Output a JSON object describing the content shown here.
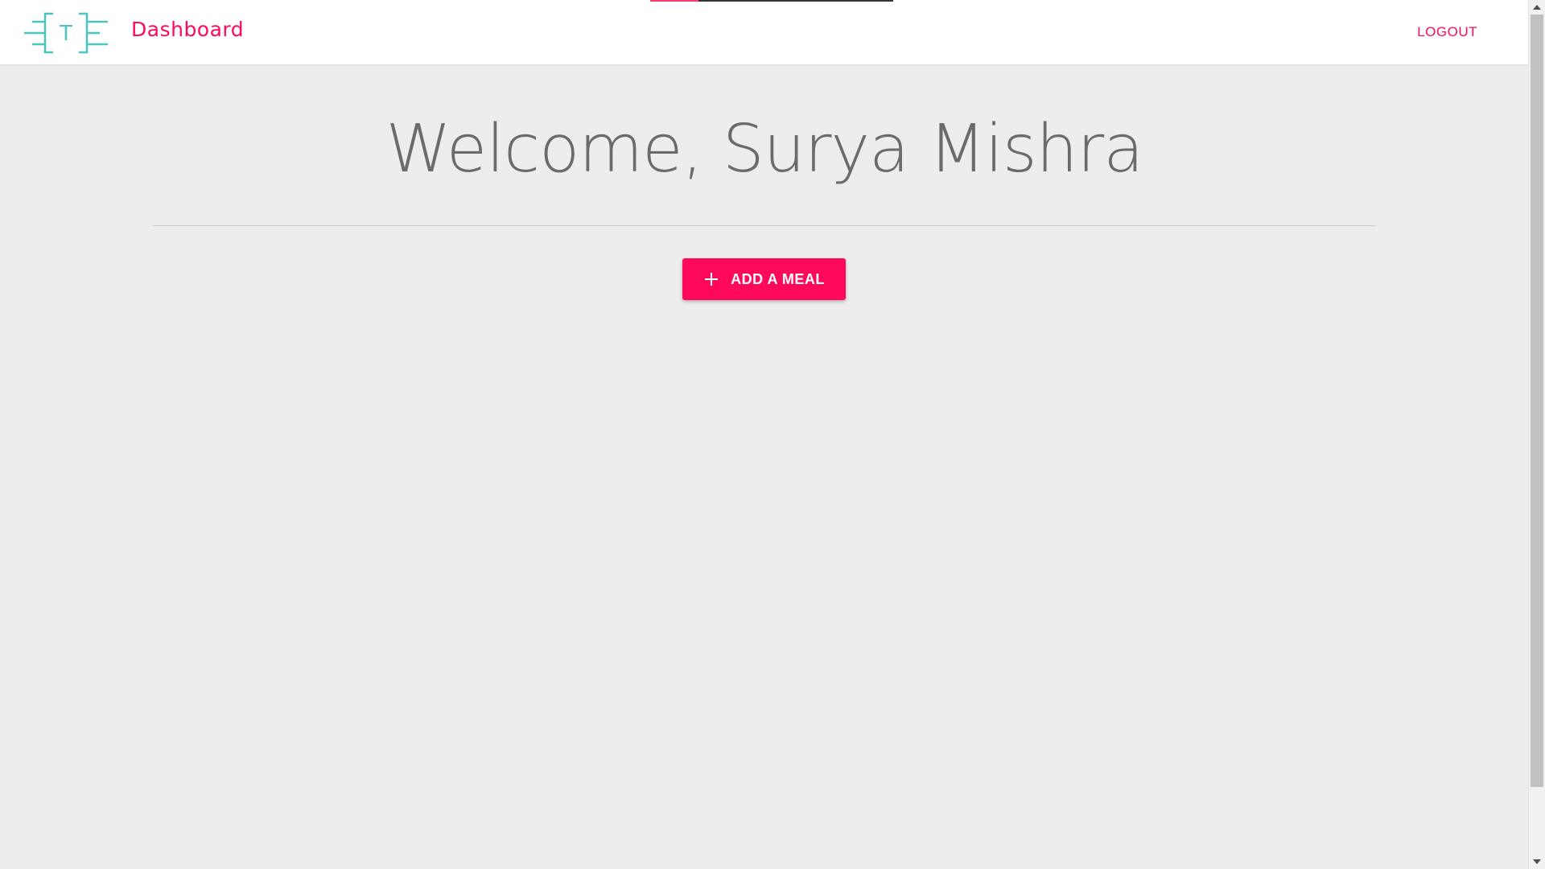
{
  "header": {
    "title": "Dashboard",
    "logo_letter": "T",
    "logout_label": "LOGOUT"
  },
  "main": {
    "welcome_text": "Welcome, Surya Mishra",
    "add_meal_label": "ADD A MEAL"
  },
  "colors": {
    "accent": "#ff0a5a",
    "logo": "#4cc5c0",
    "background": "#ededed",
    "header_bg": "#ffffff"
  },
  "loading_progress": 0.2,
  "icons": {
    "logo": "brackets-t-logo-icon",
    "add": "plus-icon"
  }
}
